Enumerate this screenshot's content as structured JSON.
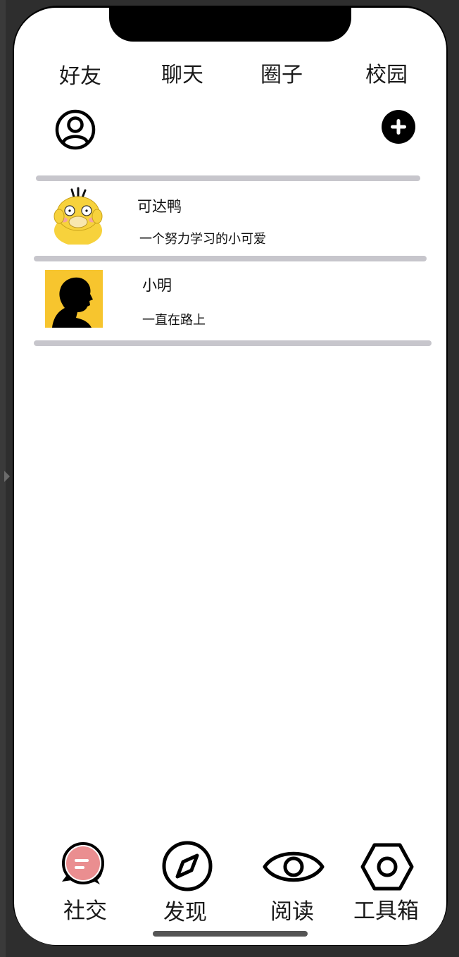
{
  "tabs": [
    {
      "label": "好友"
    },
    {
      "label": "聊天"
    },
    {
      "label": "圈子"
    },
    {
      "label": "校园"
    }
  ],
  "header": {
    "profile_icon": "user-circle-icon",
    "add_icon": "plus-circle-icon"
  },
  "friends": [
    {
      "name": "可达鸭",
      "status": "一个努力学习的小可爱",
      "avatar": "psyduck-avatar"
    },
    {
      "name": "小明",
      "status": "一直在路上",
      "avatar": "silhouette-avatar"
    }
  ],
  "bottom_nav": [
    {
      "label": "社交",
      "icon": "chat-bubbles-icon",
      "active": true
    },
    {
      "label": "发现",
      "icon": "compass-icon"
    },
    {
      "label": "阅读",
      "icon": "eye-icon"
    },
    {
      "label": "工具箱",
      "icon": "hexagon-nut-icon"
    }
  ],
  "colors": {
    "divider": "#c7c6cc",
    "active_accent": "#e8848a",
    "avatar_bg_yellow": "#f7c52e"
  }
}
